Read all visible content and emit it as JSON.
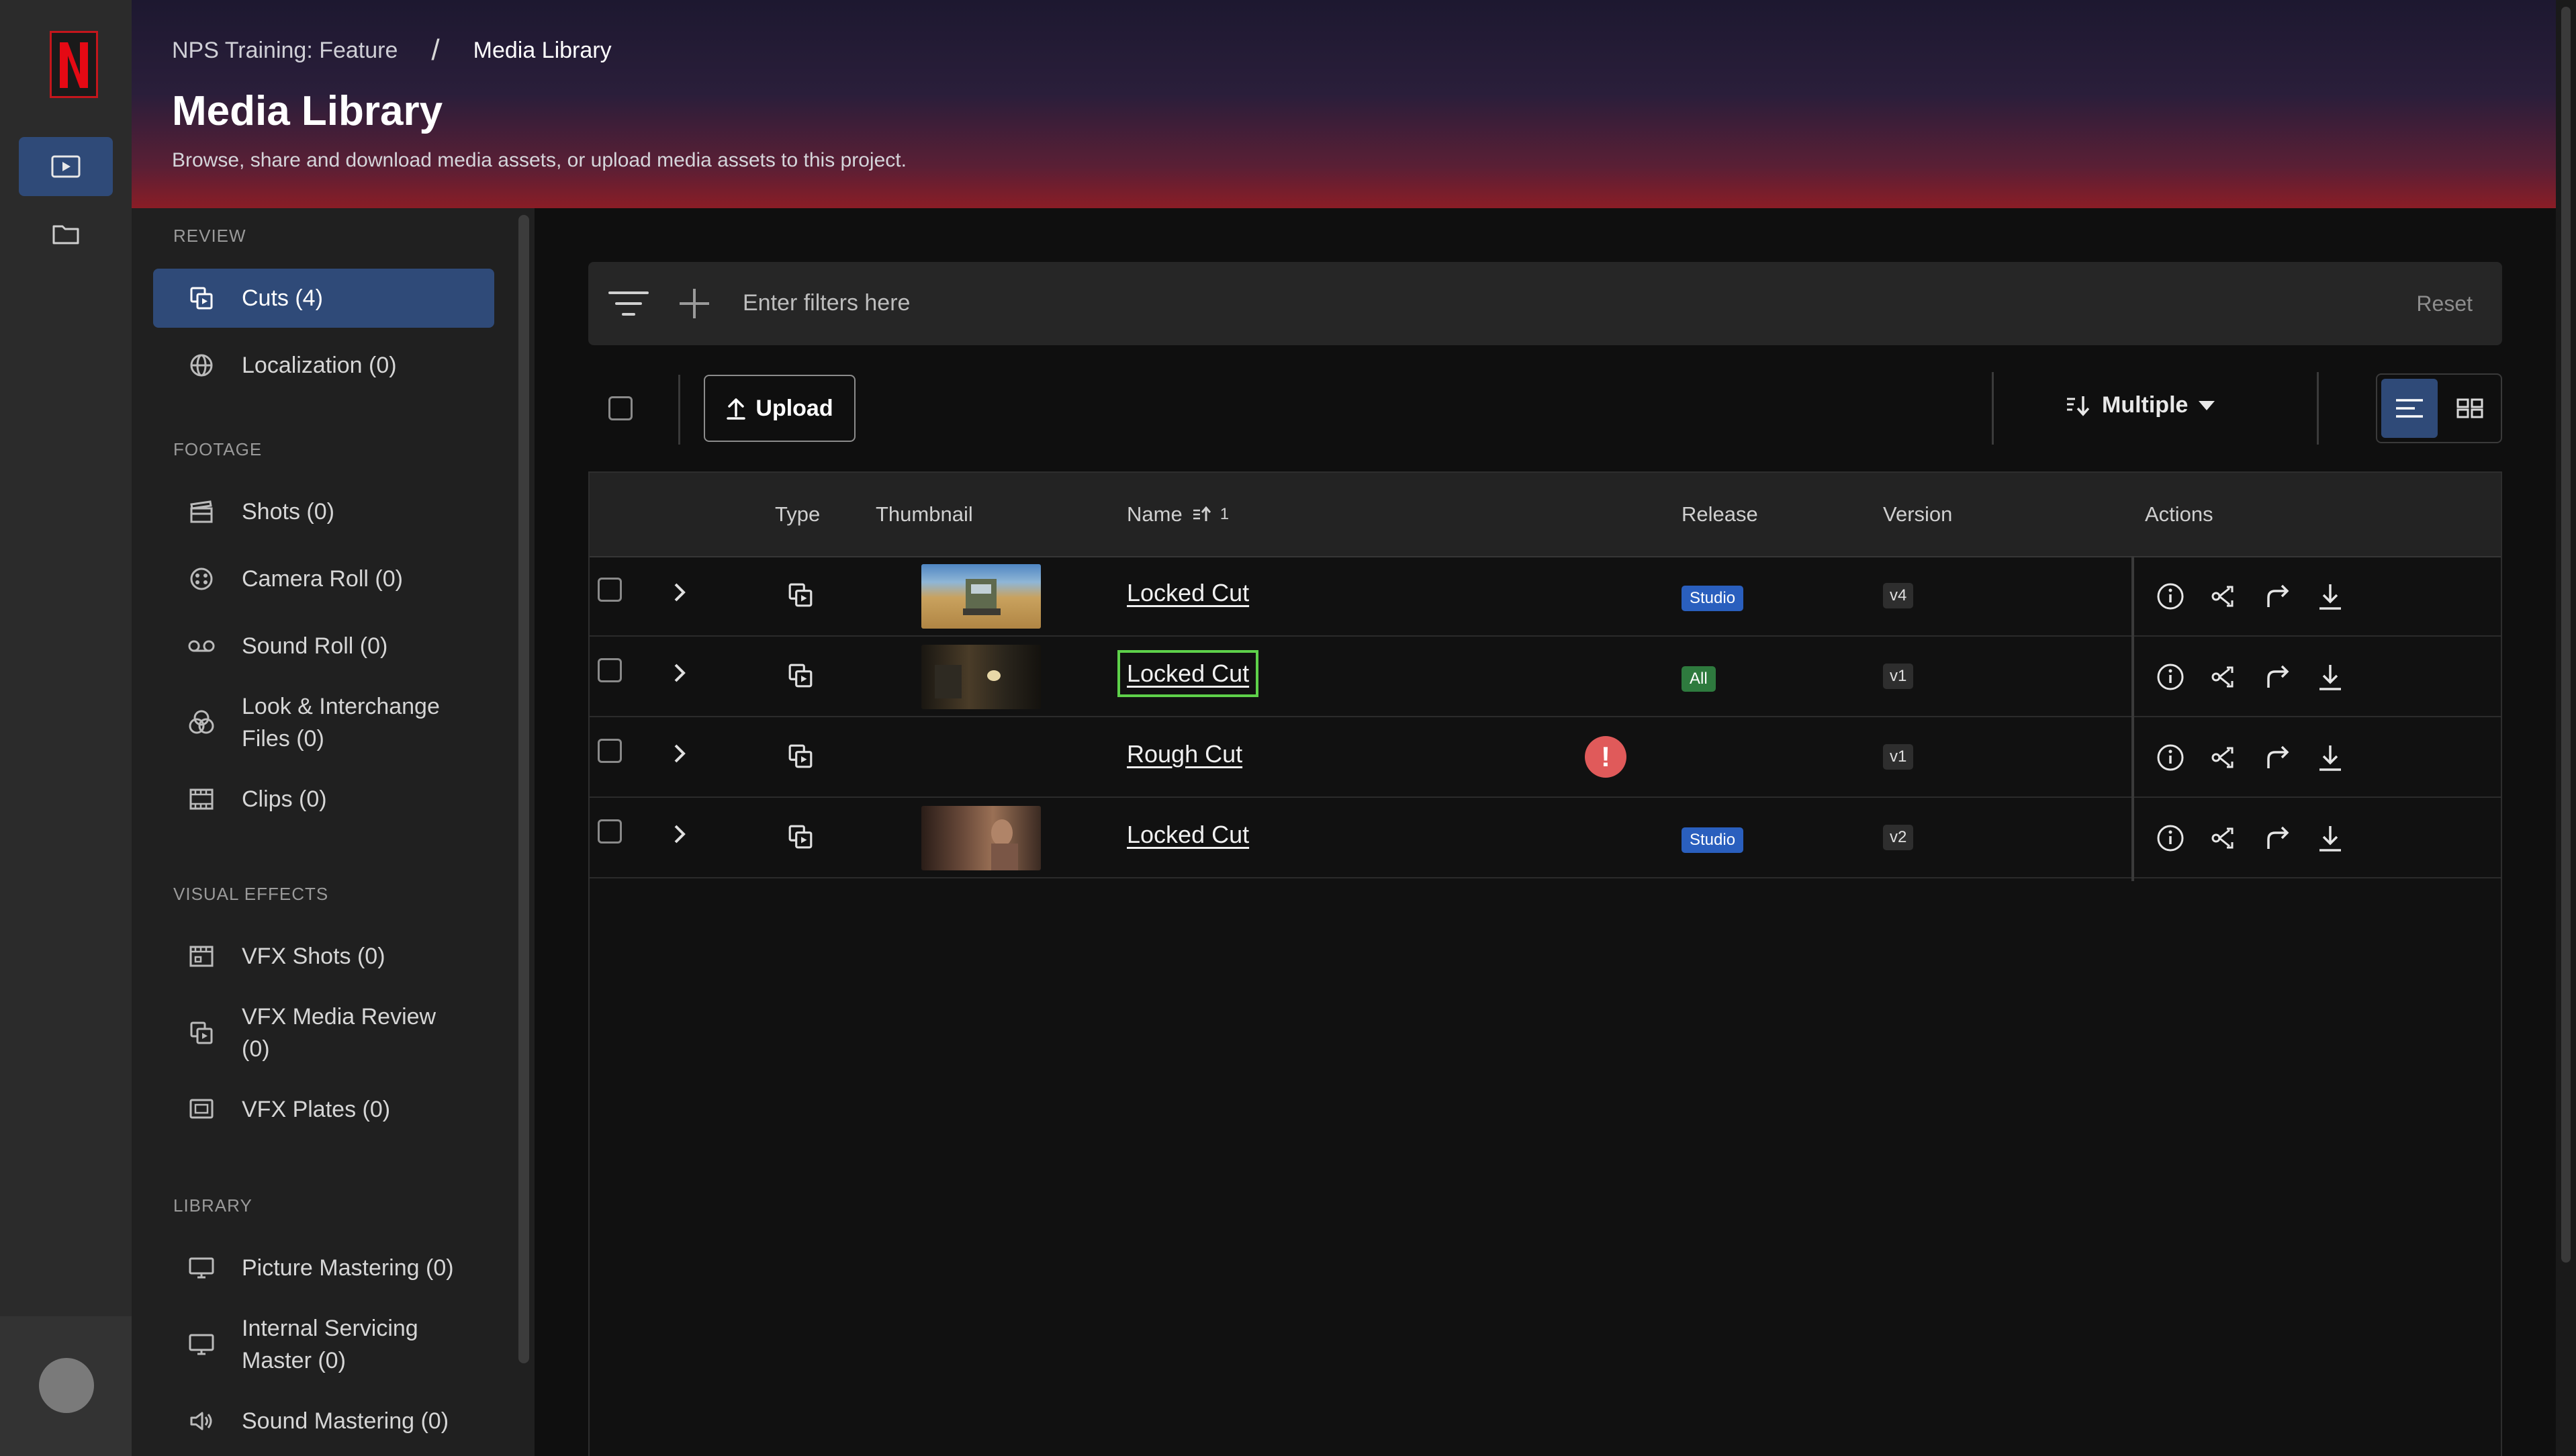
{
  "colors": {
    "accent": "#2f4a78",
    "studio_badge": "#2a5fbe",
    "all_badge": "#2e7a3e",
    "error": "#e05a5a",
    "focus": "#5ed14a"
  },
  "rail": {
    "logo_icon": "netflix-logo",
    "media_icon": "media-icon",
    "folder_icon": "folder-icon"
  },
  "header": {
    "breadcrumb": [
      "NPS Training: Feature",
      "/",
      "Media Library"
    ],
    "title": "Media Library",
    "subtitle": "Browse, share and download media assets, or upload media assets to this project."
  },
  "sidebar": {
    "sections": {
      "review": "REVIEW",
      "footage": "FOOTAGE",
      "visual_effects": "VISUAL EFFECTS",
      "library": "LIBRARY"
    },
    "items": [
      {
        "label": "Cuts (4)",
        "icon": "cuts-icon",
        "active": true
      },
      {
        "label": "Localization (0)",
        "icon": "globe-icon"
      },
      {
        "label": "Shots (0)",
        "icon": "clapperboard-icon"
      },
      {
        "label": "Camera Roll (0)",
        "icon": "film-reel-icon"
      },
      {
        "label": "Sound Roll (0)",
        "icon": "tape-icon"
      },
      {
        "label": "Look & Interchange Files (0)",
        "icon": "color-circles-icon"
      },
      {
        "label": "Clips (0)",
        "icon": "film-strip-icon"
      },
      {
        "label": "VFX Shots (0)",
        "icon": "vfx-shots-icon"
      },
      {
        "label": "VFX Media Review (0)",
        "icon": "cuts-icon"
      },
      {
        "label": "VFX Plates (0)",
        "icon": "plates-icon"
      },
      {
        "label": "Picture Mastering (0)",
        "icon": "monitor-icon"
      },
      {
        "label": "Internal Servicing Master (0)",
        "icon": "monitor-icon"
      },
      {
        "label": "Sound Mastering (0)",
        "icon": "speaker-icon"
      }
    ]
  },
  "filter": {
    "placeholder": "Enter filters here",
    "reset": "Reset"
  },
  "toolbar": {
    "upload": "Upload",
    "sort": "Multiple"
  },
  "table": {
    "headers": {
      "type": "Type",
      "thumbnail": "Thumbnail",
      "name": "Name",
      "sort_indicator": "1",
      "release": "Release",
      "version": "Version",
      "actions": "Actions"
    },
    "rows": [
      {
        "name": "Locked Cut",
        "release": "Studio",
        "version": "v4",
        "thumb": "truck"
      },
      {
        "name": "Locked Cut",
        "release": "All",
        "version": "v1",
        "thumb": "dark"
      },
      {
        "name": "Rough Cut",
        "release": "",
        "version": "v1",
        "thumb": "none",
        "error": "!"
      },
      {
        "name": "Locked Cut",
        "release": "Studio",
        "version": "v2",
        "thumb": "warm"
      }
    ],
    "action_icons": [
      "info-icon",
      "share-icon",
      "forward-icon",
      "download-icon"
    ]
  }
}
